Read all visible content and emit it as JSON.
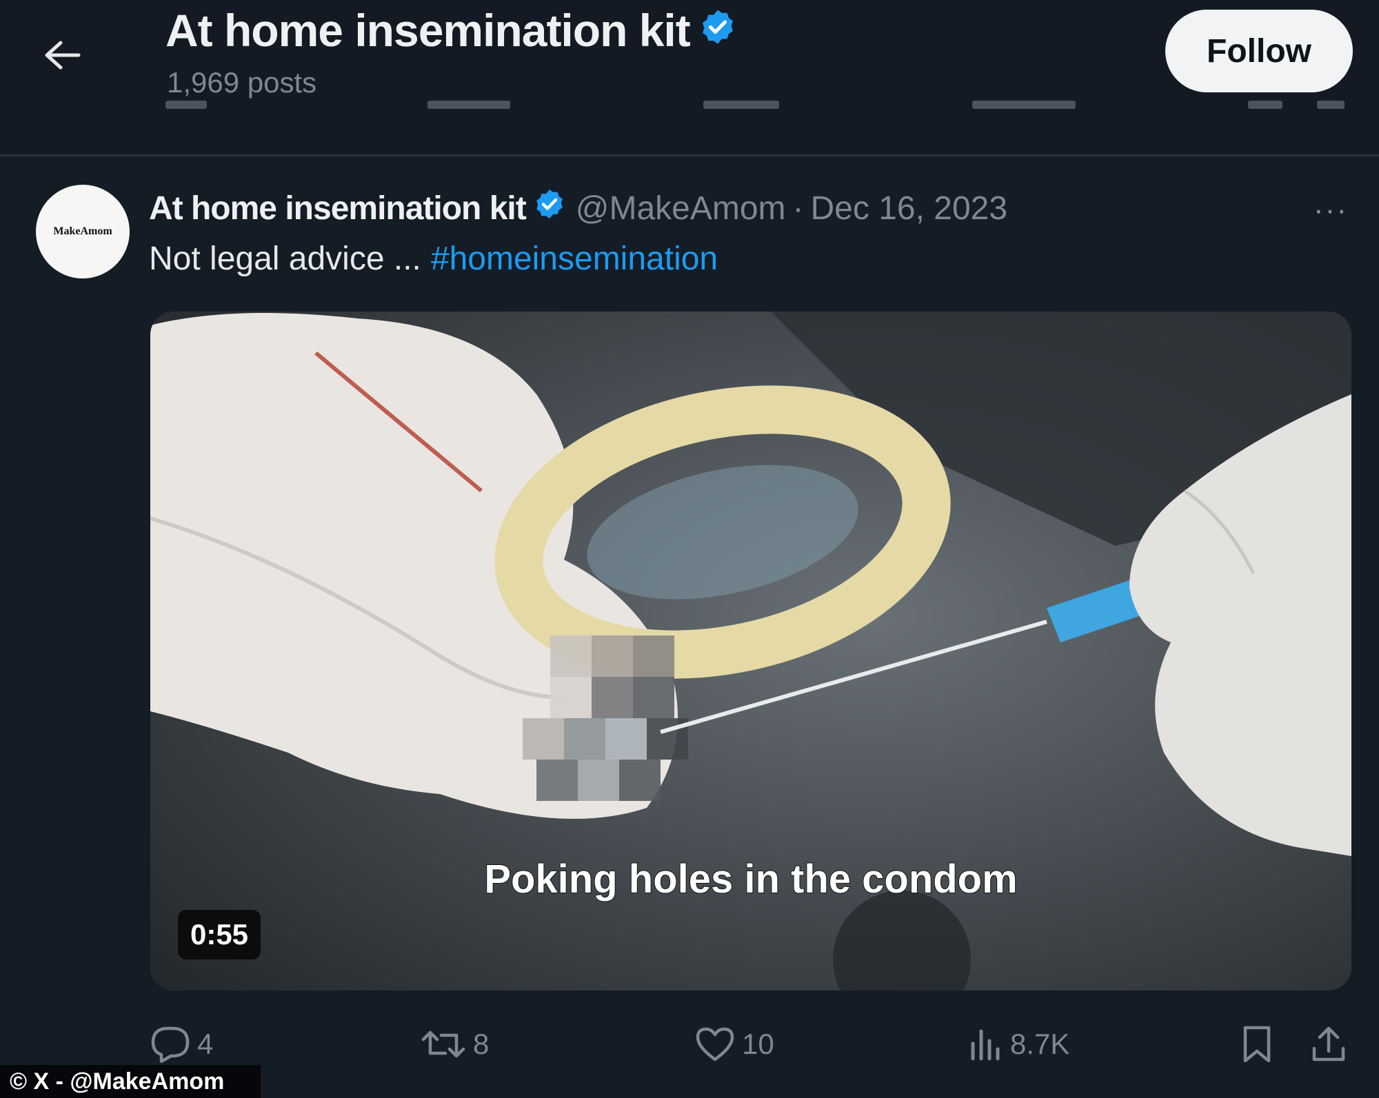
{
  "header": {
    "title": "At home insemination kit",
    "posts_count": "1,969 posts",
    "follow_label": "Follow"
  },
  "post": {
    "avatar_text": "MakeAmom",
    "author_name": "At home insemination kit",
    "handle": "@MakeAmom",
    "separator": "·",
    "date": "Dec 16, 2023",
    "text": "Not legal advice ...",
    "hashtag": "#homeinsemination",
    "more_label": "···",
    "video": {
      "caption": "Poking holes in the condom",
      "duration": "0:55"
    },
    "actions": {
      "replies": "4",
      "reposts": "8",
      "likes": "10",
      "views": "8.7K"
    }
  },
  "watermark": "© X - @MakeAmom",
  "icons": {
    "back": "arrow-left-icon",
    "verified": "verified-badge-icon",
    "reply": "reply-icon",
    "repost": "repost-icon",
    "like": "heart-icon",
    "views": "views-icon",
    "bookmark": "bookmark-icon",
    "share": "share-icon"
  },
  "colors": {
    "background": "#141c26",
    "accent": "#1d9bf0",
    "muted_text": "#7d8893",
    "follow_button": "#f1f3f4"
  }
}
